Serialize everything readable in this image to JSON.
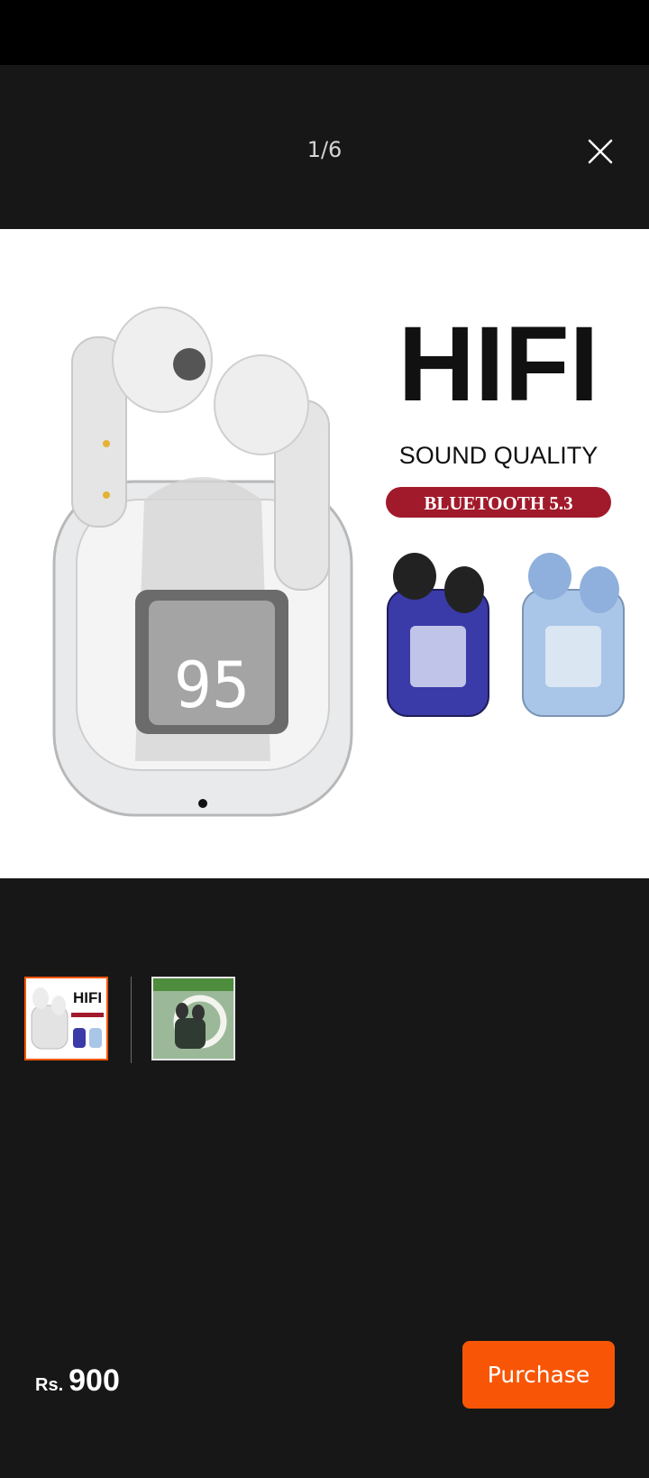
{
  "header": {
    "counter": "1/6",
    "close_icon": "close-icon"
  },
  "main_image": {
    "headline": "HIFI",
    "subheadline": "SOUND QUALITY",
    "badge": "BLUETOOTH 5.3",
    "display_digits": "95",
    "colors": {
      "badge": "#a11a2b",
      "case_blue": "#3a3aa8",
      "case_light_blue": "#a9c6e8"
    }
  },
  "thumbnails": [
    {
      "selected": true,
      "headline": "HIFI"
    },
    {
      "selected": false
    }
  ],
  "footer": {
    "currency": "Rs.",
    "price": "900",
    "purchase_label": "Purchase",
    "accent": "#f85606"
  }
}
